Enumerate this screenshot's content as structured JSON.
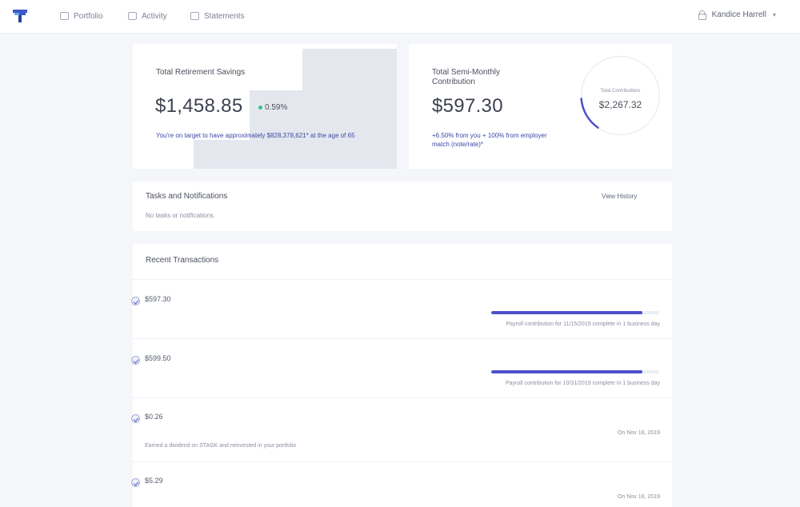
{
  "header": {
    "nav": [
      {
        "label": "Portfolio",
        "icon": "briefcase-icon"
      },
      {
        "label": "Activity",
        "icon": "calendar-icon"
      },
      {
        "label": "Statements",
        "icon": "document-icon"
      }
    ],
    "user_name": "Kandice Harrell",
    "user_caret": "▾"
  },
  "savings": {
    "title": "Total Retirement Savings",
    "amount": "$1,458.85",
    "change": "0.59%",
    "note": "You're on target to have approximately $828,378,621* at the age of 65"
  },
  "contribution": {
    "title": "Total Semi-Monthly Contribution",
    "amount": "$597.30",
    "note": "+6.50% from you + 100% from employer match (note/rate)*",
    "donut_label": "Total Contributions",
    "donut_value": "$2,267.32",
    "donut_progress": 0.14
  },
  "tasks": {
    "title": "Tasks and Notifications",
    "link": "View History",
    "empty": "No tasks or notifications."
  },
  "transactions": {
    "title": "Recent Transactions",
    "items": [
      {
        "amount": "$597.30",
        "status": "Payroll contribution for 11/15/2019 complete in 1 business day",
        "progress": 0.9
      },
      {
        "amount": "$599.50",
        "status": "Payroll contribution for 10/31/2019 complete in 1 business day",
        "progress": 0.9
      },
      {
        "amount": "$0.26",
        "date": "On Nov 18, 2019",
        "desc": "Earned a dividend on STAGK and reinvested in your portfolio"
      },
      {
        "amount": "$5.29",
        "date": "On Nov 18, 2019"
      }
    ]
  },
  "colors": {
    "accent": "#4b50c9",
    "positive": "#31c48d",
    "link": "#3d47a8",
    "background": "#f4f6f9"
  }
}
